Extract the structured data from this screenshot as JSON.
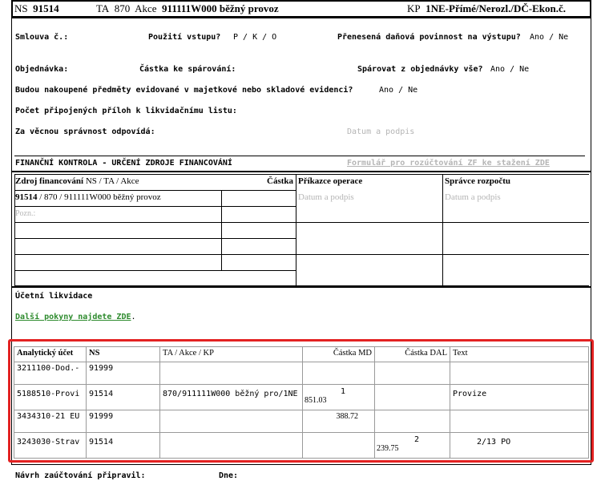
{
  "header": {
    "ns_label": "NS",
    "ns_value": "91514",
    "ta_label": "TA",
    "ta_value": "870",
    "akce_label": "Akce",
    "akce_value": "911111W000 běžný provoz",
    "kp_label": "KP",
    "kp_value": "1NE-Přímé/Nerozl./DČ-Ekon.č."
  },
  "form": {
    "smlouva": "Smlouva č.:",
    "pouziti": "Použití vstupu?",
    "pouziti_opts": "P / K / O",
    "prenesena": "Přenesená daňová povinnost na výstupu?",
    "prenesena_opts": "Ano / Ne",
    "objednavka": "Objednávka:",
    "castka_sparovani": "Částka ke spárování:",
    "sparovat": "Spárovat z objednávky vše?",
    "sparovat_opts": "Ano / Ne",
    "budou": "Budou nakoupené předměty evidované v majetkové nebo skladové evidenci?",
    "budou_opts": "Ano / Ne",
    "pocet": "Počet připojených příloh k likvidačnímu listu:",
    "vecna": "Za věcnou správnost odpovídá:",
    "datum_podpis": "Datum a podpis",
    "financni": "FINANČNÍ KONTROLA - URČENÍ ZDROJE FINANCOVÁNÍ",
    "formular_link": "Formulář pro rozúčtování ZF ke stažení ZDE"
  },
  "funding": {
    "zdroj_label": "Zdroj financování",
    "zdroj_sub": "NS / TA / Akce",
    "castka": "Částka",
    "prikazce": "Příkazce operace",
    "spravce": "Správce rozpočtu",
    "row_ns": "91514",
    "row_rest": "/ 870 / 911111W000 běžný provoz",
    "pozn": "Pozn.:",
    "datum_podpis_1": "Datum a podpis",
    "datum_podpis_2": "Datum a podpis"
  },
  "ucetni": {
    "title": "Účetní likvidace",
    "link": "Další pokyny najdete ZDE",
    "link_suffix": "."
  },
  "accounting": {
    "headers": [
      "Analytický účet",
      "NS",
      "TA / Akce / KP",
      "Částka MD",
      "Částka DAL",
      "Text"
    ],
    "rows": [
      {
        "ucet": "3211100-Dod.-",
        "ns": "91999",
        "ta": "",
        "md1": "",
        "md2": "",
        "dal1": "",
        "dal2": "",
        "text": ""
      },
      {
        "ucet": "5188510-Provi",
        "ns": "91514",
        "ta": "870/911111W000 běžný pro/1NE",
        "md1": "1",
        "md2": "851.03",
        "dal1": "",
        "dal2": "",
        "text": "Provize"
      },
      {
        "ucet": "3434310-21 EU",
        "ns": "91999",
        "ta": "",
        "md1": "388.72",
        "md2": "",
        "dal1": "",
        "dal2": "",
        "text": ""
      },
      {
        "ucet": "3243030-Strav",
        "ns": "91514",
        "ta": "",
        "md1": "",
        "md2": "",
        "dal1": "2",
        "dal2": "239.75",
        "text": "2/13 PO"
      }
    ]
  },
  "footer": {
    "navrh": "Návrh zaúčtování připravil:",
    "dne": "Dne:"
  },
  "colors": {
    "highlight": "#e32222",
    "link_green": "#2e8b2e",
    "placeholder_gray": "#b5b5b5"
  }
}
